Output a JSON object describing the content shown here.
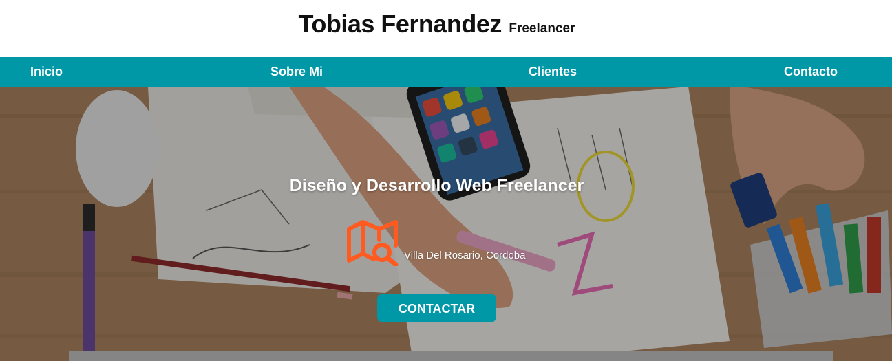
{
  "header": {
    "name": "Tobias Fernandez",
    "role": "Freelancer"
  },
  "nav": {
    "items": [
      {
        "label": "Inicio"
      },
      {
        "label": "Sobre Mi"
      },
      {
        "label": "Clientes"
      },
      {
        "label": "Contacto"
      }
    ]
  },
  "hero": {
    "title": "Diseño y Desarrollo Web Freelancer",
    "location_icon": "map-search-icon",
    "location": "Villa Del Rosario, Cordoba",
    "cta_label": "CONTACTAR"
  },
  "colors": {
    "accent": "#0097a7",
    "icon": "#ff5a1f",
    "header_bg": "#ffffff",
    "text_dark": "#111111"
  }
}
